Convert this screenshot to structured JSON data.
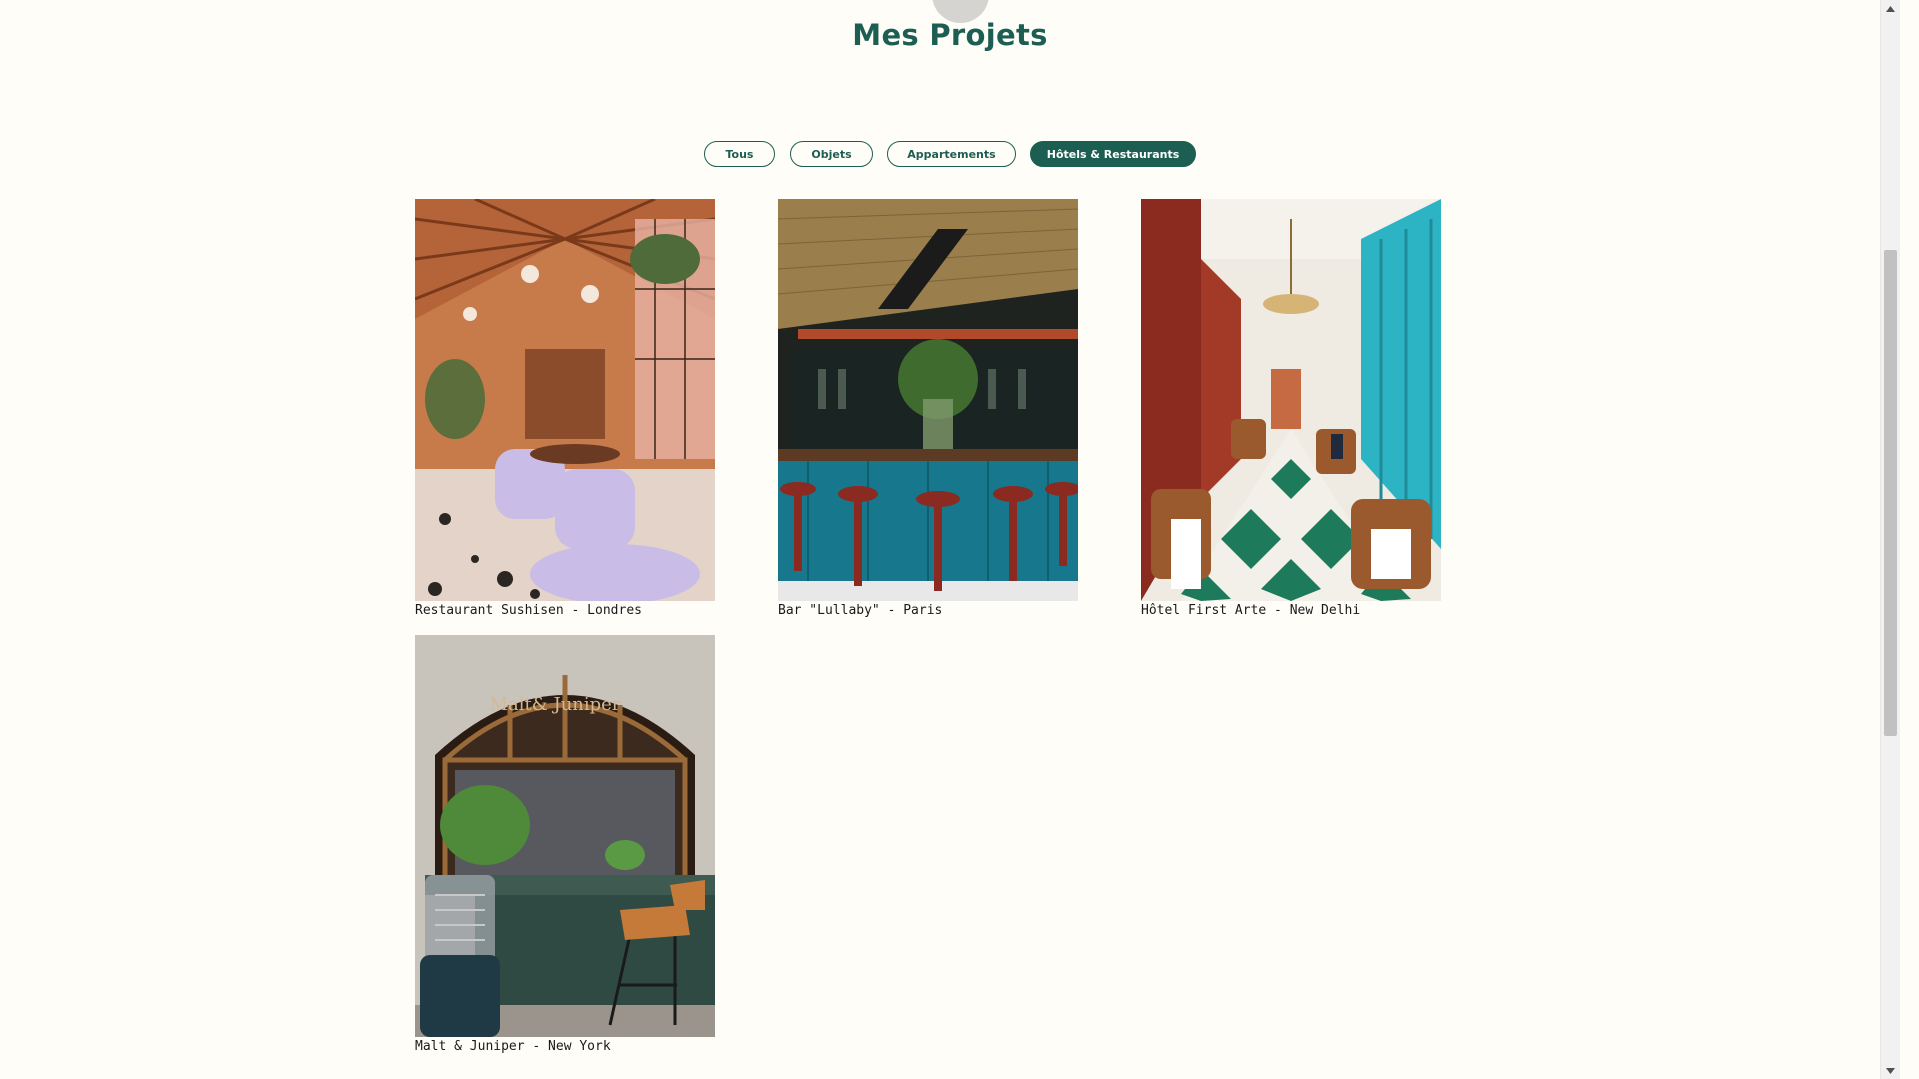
{
  "page": {
    "title": "Mes Projets"
  },
  "filters": [
    {
      "label": "Tous",
      "active": false
    },
    {
      "label": "Objets",
      "active": false
    },
    {
      "label": "Appartements",
      "active": false
    },
    {
      "label": "Hôtels & Restaurants",
      "active": true
    }
  ],
  "projects": [
    {
      "caption": "Restaurant Sushisen - Londres"
    },
    {
      "caption": "Bar \"Lullaby\" - Paris"
    },
    {
      "caption": "Hôtel First Arte - New Delhi"
    },
    {
      "caption": "Malt & Juniper - New York",
      "sign_text": "Malt& Juniper"
    }
  ],
  "colors": {
    "accent": "#1d5e52",
    "background": "#fffdf8"
  },
  "icons": {
    "scroll_up": "chevron-up-icon",
    "scroll_down": "chevron-down-icon"
  }
}
